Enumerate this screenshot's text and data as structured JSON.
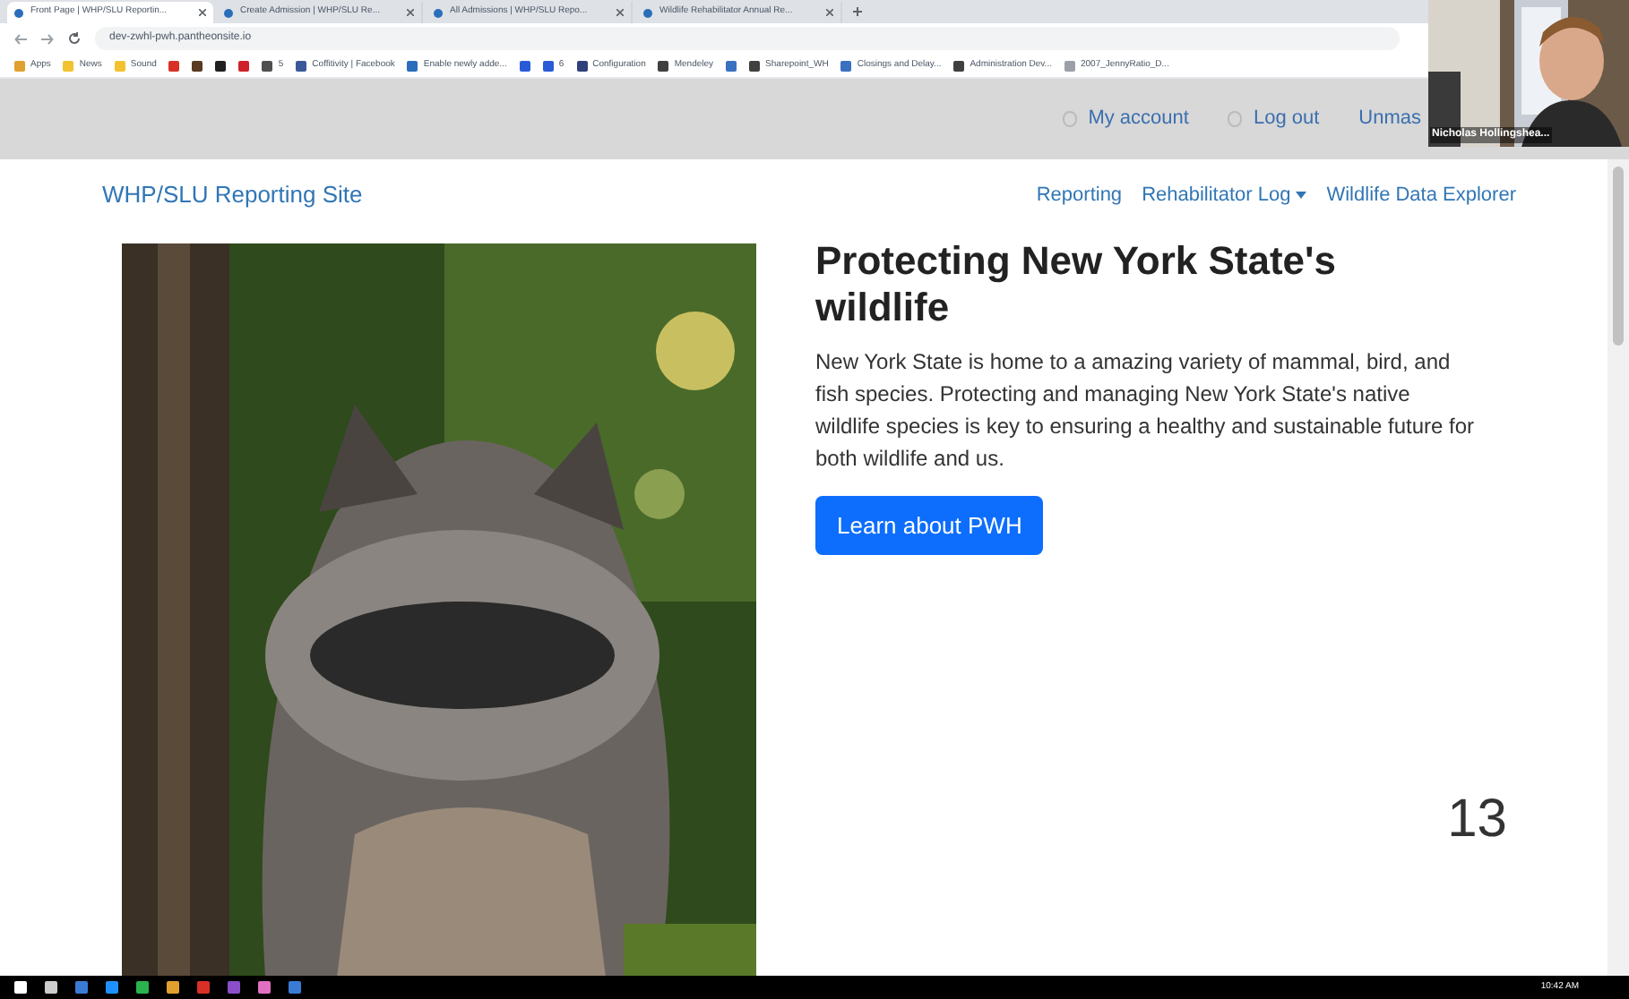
{
  "browser": {
    "tabs": [
      {
        "title": "Front Page | WHP/SLU Reportin...",
        "selected": true
      },
      {
        "title": "Create Admission | WHP/SLU Re...",
        "selected": false
      },
      {
        "title": "All Admissions | WHP/SLU Repo...",
        "selected": false
      },
      {
        "title": "Wildlife Rehabilitator Annual Re...",
        "selected": false
      }
    ],
    "address": "dev-zwhl-pwh.pantheonsite.io",
    "bookmarks": [
      {
        "kind": "link",
        "label": "Apps",
        "color": "#e0a030"
      },
      {
        "kind": "link",
        "label": "News",
        "color": "#f2c230"
      },
      {
        "kind": "link",
        "label": "Sound",
        "color": "#f2c230"
      },
      {
        "kind": "icon",
        "color": "#d93025"
      },
      {
        "kind": "icon",
        "color": "#5a3a20"
      },
      {
        "kind": "icon",
        "color": "#202020"
      },
      {
        "kind": "icon",
        "color": "#d0202a"
      },
      {
        "kind": "link",
        "label": "5",
        "color": "#505050"
      },
      {
        "kind": "link",
        "label": "Coffitivity | Facebook",
        "color": "#3b5998"
      },
      {
        "kind": "link",
        "label": "Enable newly adde...",
        "color": "#2a6ebb"
      },
      {
        "kind": "icon",
        "color": "#2a5bd7"
      },
      {
        "kind": "link",
        "label": "6",
        "color": "#2a5bd7"
      },
      {
        "kind": "link",
        "label": "Configuration",
        "color": "#30407a"
      },
      {
        "kind": "link",
        "label": "Mendeley",
        "color": "#404040"
      },
      {
        "kind": "icon",
        "color": "#3a70c0"
      },
      {
        "kind": "link",
        "label": "Sharepoint_WH",
        "color": "#404040"
      },
      {
        "kind": "link",
        "label": "Closings and Delay...",
        "color": "#3a70c0"
      },
      {
        "kind": "link",
        "label": "Administration Dev...",
        "color": "#404040"
      },
      {
        "kind": "link",
        "label": "2007_JennyRatio_D...",
        "color": "#9aa0a6"
      }
    ]
  },
  "site": {
    "account_links": [
      "My account",
      "Log out",
      "Unmas"
    ],
    "brand": "WHP/SLU Reporting Site",
    "nav": [
      {
        "label": "Reporting",
        "dropdown": false
      },
      {
        "label": "Rehabilitator Log",
        "dropdown": true
      },
      {
        "label": "Wildlife Data Explorer",
        "dropdown": false
      }
    ],
    "hero": {
      "title": "Protecting New York State's wildlife",
      "body": "New York State is home to a amazing variety of mammal, bird, and fish species. Protecting and managing New York State's native wildlife species is key to ensuring a healthy and sustainable future for both wildlife and us.",
      "button": "Learn about PWH"
    }
  },
  "slide_number": "13",
  "webcam": {
    "name": "Nicholas Hollingshea..."
  },
  "taskbar": {
    "clock": "10:42 AM"
  }
}
